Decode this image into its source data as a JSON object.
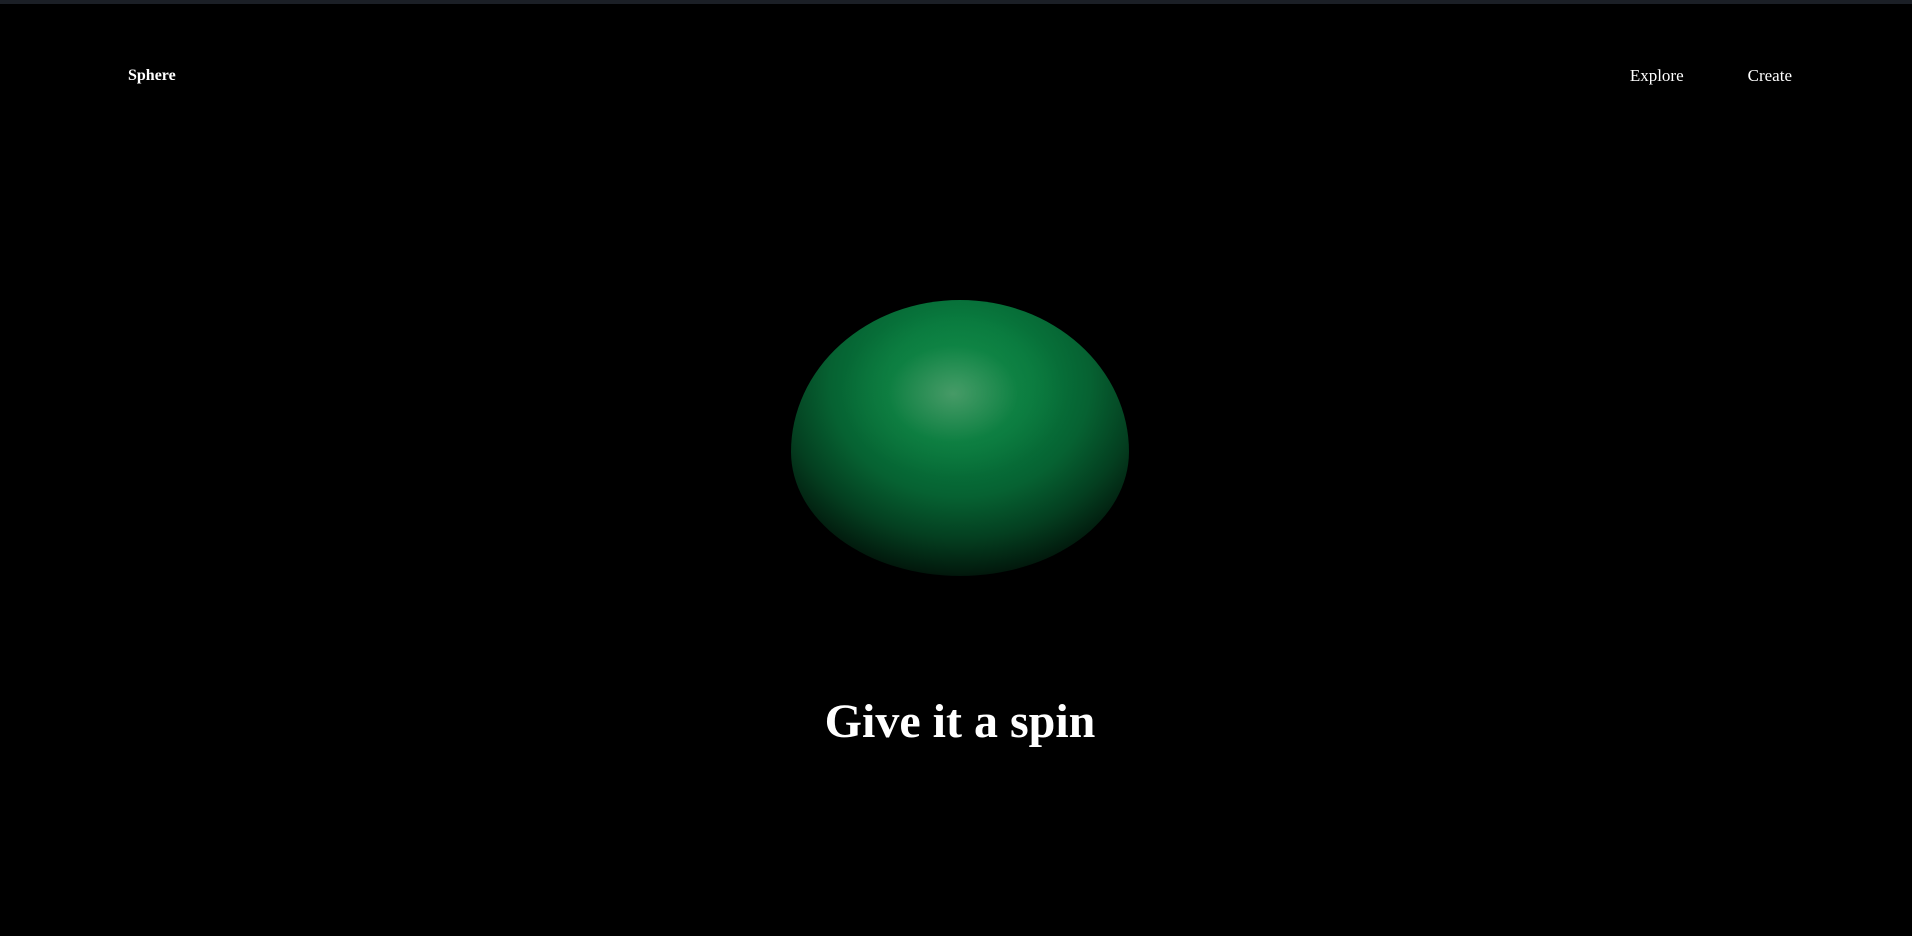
{
  "nav": {
    "logo_label": "Sphere",
    "links": [
      {
        "label": "Explore"
      },
      {
        "label": "Create"
      }
    ]
  },
  "hero": {
    "headline": "Give it a spin",
    "sphere_color": "#0b8a47"
  },
  "colors": {
    "background": "#000000",
    "text": "#ffffff",
    "top_strip": "#1b1f26"
  }
}
